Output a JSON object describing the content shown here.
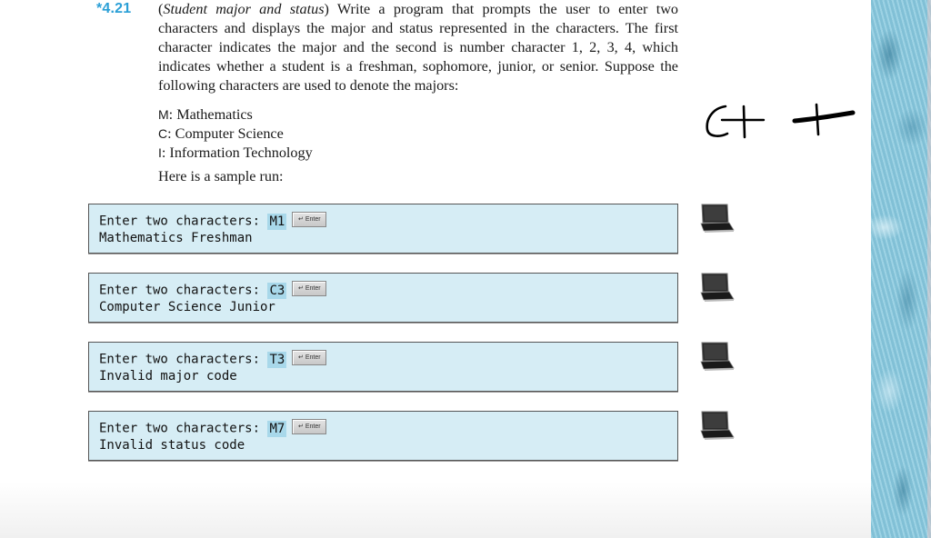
{
  "exercise": {
    "number": "*4.21",
    "title": "Student major and status",
    "body": " Write a program that prompts the user to enter two characters and displays the major and status represented in the characters. The first character indicates the major and the second is number character 1, 2, 3, 4, which indicates whether a student is a freshman, sophomore, junior, or senior. Suppose the following characters are used to denote the majors:",
    "majors": [
      {
        "code": "M",
        "name": ": Mathematics"
      },
      {
        "code": "C",
        "name": ": Computer Science"
      },
      {
        "code": "I",
        "name": ": Information Technology"
      }
    ],
    "sample_intro": "Here is a sample run:"
  },
  "sample_runs": [
    {
      "prompt": "Enter two characters: ",
      "input": "M1",
      "key": "↵ Enter",
      "output": "Mathematics Freshman"
    },
    {
      "prompt": "Enter two characters: ",
      "input": "C3",
      "key": "↵ Enter",
      "output": "Computer Science Junior"
    },
    {
      "prompt": "Enter two characters: ",
      "input": "T3",
      "key": "↵ Enter",
      "output": "Invalid major code"
    },
    {
      "prompt": "Enter two characters: ",
      "input": "M7",
      "key": "↵ Enter",
      "output": "Invalid status code"
    }
  ],
  "annotation": {
    "handwritten_text": "C++"
  },
  "colors": {
    "exercise_number": "#2a9fd6",
    "run_box_bg": "#d6edf5",
    "user_input_highlight": "#a8d8ea",
    "texture_strip": "#8ccbe0"
  }
}
